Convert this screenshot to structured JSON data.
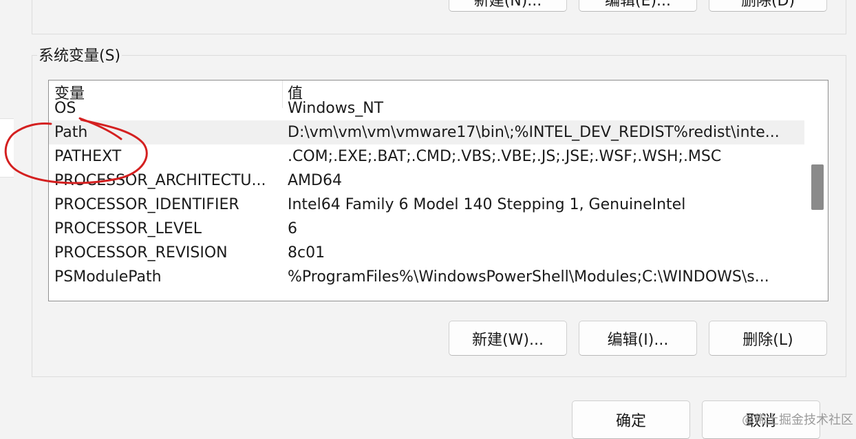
{
  "window": {
    "top_buttons": [
      {
        "label": "新建(N)..."
      },
      {
        "label": "编辑(E)..."
      },
      {
        "label": "删除(D)"
      }
    ]
  },
  "system_variables": {
    "title": "系统变量(S)",
    "columns": [
      "变量",
      "值"
    ],
    "rows": [
      {
        "name": "OS",
        "value": "Windows_NT"
      },
      {
        "name": "Path",
        "value": "D:\\vm\\vm\\vm\\vmware17\\bin\\;%INTEL_DEV_REDIST%redist\\inte..."
      },
      {
        "name": "PATHEXT",
        "value": ".COM;.EXE;.BAT;.CMD;.VBS;.VBE;.JS;.JSE;.WSF;.WSH;.MSC"
      },
      {
        "name": "PROCESSOR_ARCHITECTU...",
        "value": "AMD64"
      },
      {
        "name": "PROCESSOR_IDENTIFIER",
        "value": "Intel64 Family 6 Model 140 Stepping 1, GenuineIntel"
      },
      {
        "name": "PROCESSOR_LEVEL",
        "value": "6"
      },
      {
        "name": "PROCESSOR_REVISION",
        "value": "8c01"
      },
      {
        "name": "PSModulePath",
        "value": "%ProgramFiles%\\WindowsPowerShell\\Modules;C:\\WINDOWS\\s..."
      }
    ],
    "selected_row": "Path",
    "buttons": {
      "new": "新建(W)...",
      "edit": "编辑(I)...",
      "delete": "删除(L)"
    }
  },
  "dialog_buttons": {
    "ok": "确定",
    "cancel": "取消"
  },
  "watermark": "@稀土掘金技术社区",
  "colors": {
    "annotation": "#d42020",
    "selected_row": "#f0f0f0",
    "scroll_thumb": "#8a8a8a"
  }
}
